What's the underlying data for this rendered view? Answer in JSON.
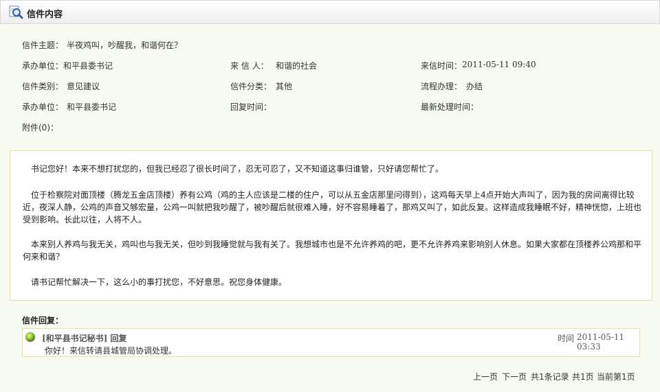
{
  "header": {
    "title": "信件内容",
    "icon": "search-magnifier-icon"
  },
  "meta": {
    "subject_label": "信件主题：",
    "subject_value": "半夜鸡叫，吵醒我，和谐何在？",
    "unit_label": "承办单位：",
    "unit_value": "和平县委书记",
    "sender_label": "来 信 人：",
    "sender_value": "和谐的社会",
    "time_label": "来信时间：",
    "time_value": "2011-05-11 09:40",
    "category_label": "信件类别：",
    "category_value": "意见建议",
    "class_label": "信件分类：",
    "class_value": "其他",
    "process_label": "流程办理：",
    "process_value": "办结",
    "unit2_label": "承办单位：",
    "unit2_value": "和平县委书记",
    "reply_time_label": "回复时间：",
    "reply_time_value": "",
    "latest_label": "最新处理时间：",
    "latest_value": "",
    "attach_label": "附件(0)："
  },
  "content": {
    "paragraphs": [
      "　书记您好！本来不想打扰您的，但我已经忍了很长时间了，忍无可忍了，又不知道这事归谁管，只好请您帮忙了。",
      "　位于检察院对面顶楼（腾龙五金店顶楼）养有公鸡（鸡的主人应该是二楼的住户，可以从五金店那里问得到），这鸡每天早上4点开始大声叫了，因为我的房间离得比较近，夜深人静，公鸡的声音又够宏量，公鸡一叫就把我吵醒了，被吵醒后就很难入睡，好不容易睡着了，那鸡又叫了，如此反复。这样造成我睡眠不好，精神恍惚，上班也受到影响。长此以往，人将不人。",
      "　本来别人养鸡与我无关，鸡叫也与我无关，但吵到我睡觉就与我有关了。我想城市也是不允许养鸡的吧，更不允许养鸡来影响别人休息。如果大家都在顶楼养公鸡那和平何来和谐？",
      "　请书记帮忙解决一下，这么小的事打扰您，不好意思。祝您身体健康。"
    ]
  },
  "reply": {
    "heading": "信件回复：",
    "author": "[和平县书记秘书] 回复",
    "time_label": "时间",
    "time_value": "2011-05-11 03:33",
    "text": "你好！来信转请县城管局协调处理。",
    "status_color": "#7ab317"
  },
  "pager": {
    "prev": "上一页",
    "next": "下一页",
    "total_records": "共1条记录",
    "total_pages": "共1页",
    "current": "当前第1页"
  }
}
